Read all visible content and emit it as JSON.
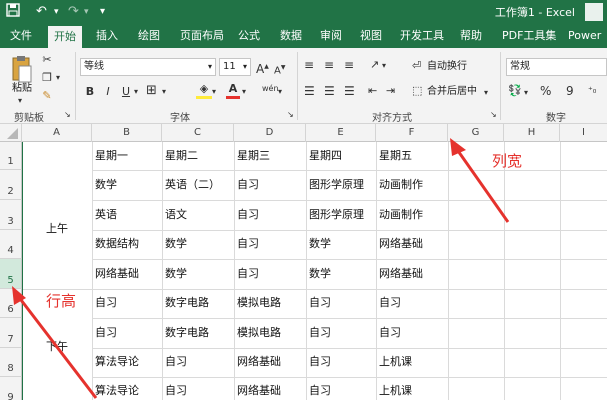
{
  "titlebar": {
    "title": "工作簿1 - Excel",
    "save_icon": "save-icon",
    "undo_icon": "undo-icon",
    "redo_icon": "redo-icon",
    "customize_icon": "customize-qat-icon"
  },
  "tabs": [
    "文件",
    "开始",
    "插入",
    "绘图",
    "页面布局",
    "公式",
    "数据",
    "审阅",
    "视图",
    "开发工具",
    "帮助",
    "PDF工具集",
    "Power P"
  ],
  "ribbon": {
    "clipboard": {
      "paste_label": "粘贴",
      "group_label": "剪贴板"
    },
    "font": {
      "font_name": "等线",
      "font_size": "11",
      "bold": "B",
      "italic": "I",
      "underline": "U",
      "font_color_glyph": "A",
      "font_size_inc": "A",
      "font_size_dec": "A",
      "phonetic": "wén",
      "group_label": "字体"
    },
    "alignment": {
      "wrap_text": "自动换行",
      "merge_center": "合并后居中",
      "group_label": "对齐方式"
    },
    "number": {
      "format": "常规",
      "percent": "%",
      "comma": "9",
      "group_label": "数字"
    }
  },
  "columns": [
    "A",
    "B",
    "C",
    "D",
    "E",
    "F",
    "G",
    "H",
    "I"
  ],
  "rows": [
    "1",
    "2",
    "3",
    "4",
    "5",
    "6",
    "7",
    "8",
    "9"
  ],
  "selected_row": "5",
  "sheet": {
    "a_morning": "上午",
    "a_afternoon": "下午",
    "grid": [
      [
        "星期一",
        "星期二",
        "星期三",
        "星期四",
        "星期五"
      ],
      [
        "数学",
        "英语（二）",
        "自习",
        "图形学原理",
        "动画制作"
      ],
      [
        "英语",
        "语文",
        "自习",
        "图形学原理",
        "动画制作"
      ],
      [
        "数据结构",
        "数学",
        "自习",
        "数学",
        "网络基础"
      ],
      [
        "网络基础",
        "数学",
        "自习",
        "数学",
        "网络基础"
      ],
      [
        "自习",
        "数字电路",
        "模拟电路",
        "自习",
        "自习"
      ],
      [
        "自习",
        "数字电路",
        "模拟电路",
        "自习",
        "自习"
      ],
      [
        "算法导论",
        "自习",
        "网络基础",
        "自习",
        "上机课"
      ],
      [
        "算法导论",
        "自习",
        "网络基础",
        "自习",
        "上机课"
      ]
    ]
  },
  "annotations": {
    "col_width": "列宽",
    "row_height": "行高",
    "color": "#e5322d"
  },
  "colors": {
    "accent": "#217346",
    "ribbon_bg": "#f3f3f3"
  }
}
